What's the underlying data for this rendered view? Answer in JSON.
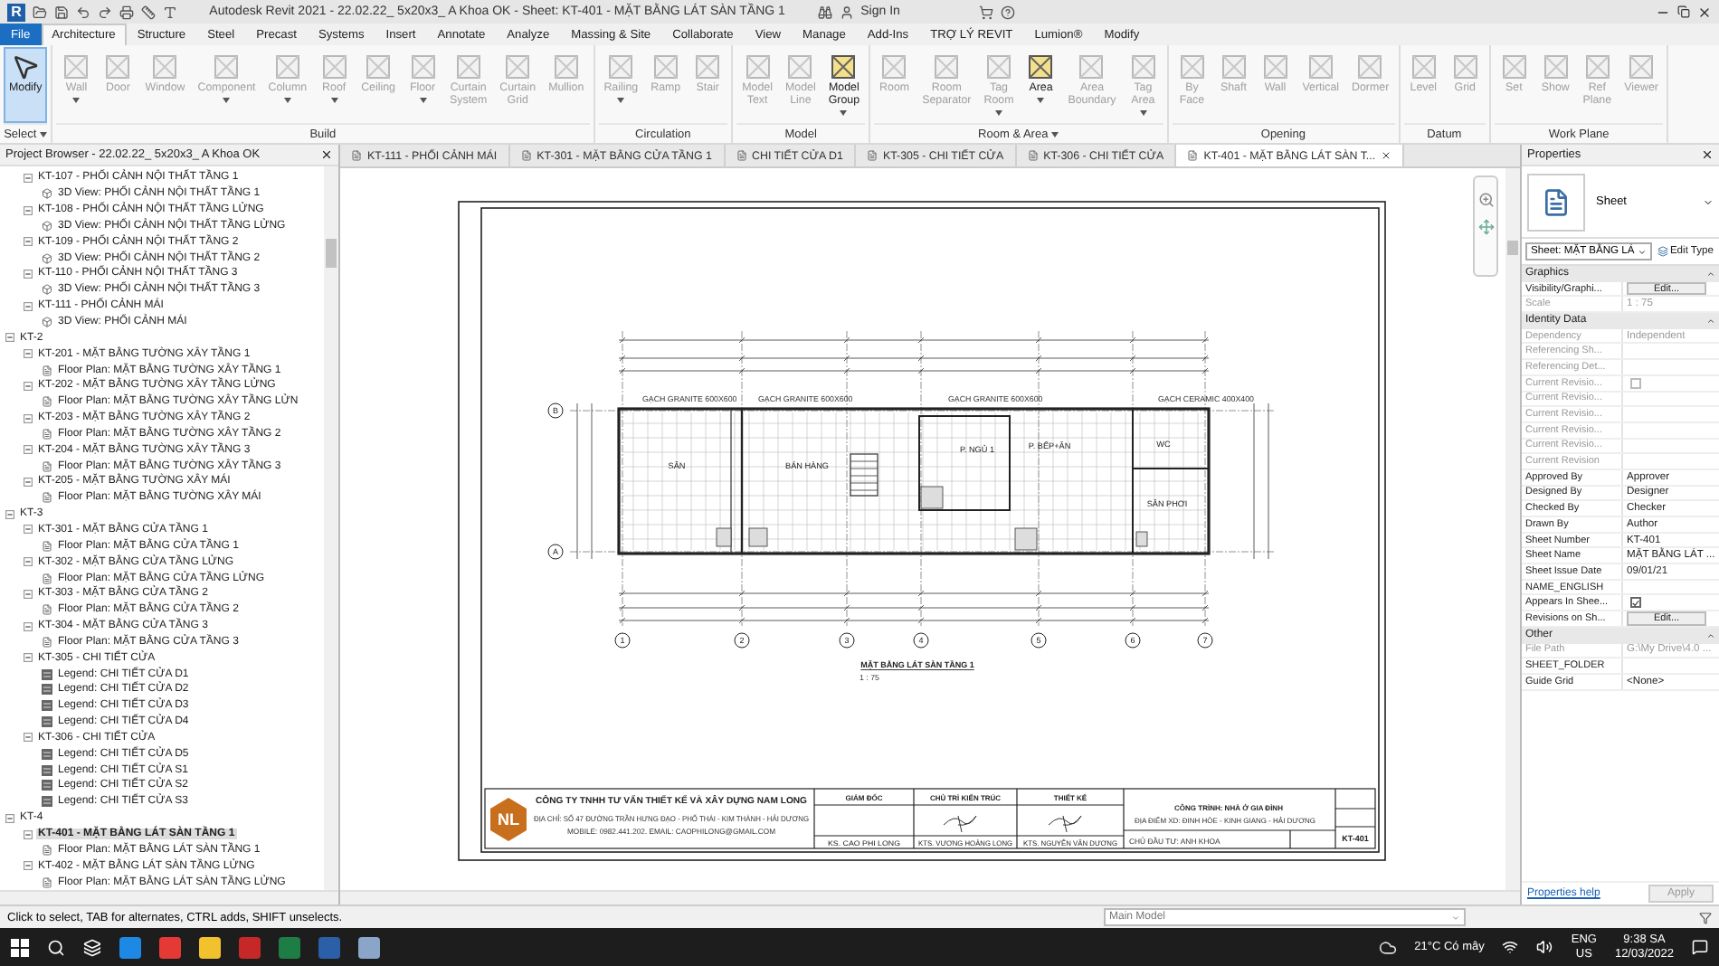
{
  "title_bar": {
    "logo": "R",
    "title": "Autodesk Revit 2021 - 22.02.22_ 5x20x3_ A Khoa OK - Sheet: KT-401 - MẶT BẰNG LÁT SÀN TẦNG 1",
    "sign_in": "Sign In"
  },
  "ribbon": {
    "tabs": [
      {
        "label": "File",
        "kind": "file",
        "selected": false
      },
      {
        "label": "Architecture",
        "kind": "tab",
        "selected": true
      },
      {
        "label": "Structure",
        "kind": "tab",
        "selected": false
      },
      {
        "label": "Steel",
        "kind": "tab",
        "selected": false
      },
      {
        "label": "Precast",
        "kind": "tab",
        "selected": false
      },
      {
        "label": "Systems",
        "kind": "tab",
        "selected": false
      },
      {
        "label": "Insert",
        "kind": "tab",
        "selected": false
      },
      {
        "label": "Annotate",
        "kind": "tab",
        "selected": false
      },
      {
        "label": "Analyze",
        "kind": "tab",
        "selected": false
      },
      {
        "label": "Massing & Site",
        "kind": "tab",
        "selected": false
      },
      {
        "label": "Collaborate",
        "kind": "tab",
        "selected": false
      },
      {
        "label": "View",
        "kind": "tab",
        "selected": false
      },
      {
        "label": "Manage",
        "kind": "tab",
        "selected": false
      },
      {
        "label": "Add-Ins",
        "kind": "tab",
        "selected": false
      },
      {
        "label": "TRỢ LÝ REVIT",
        "kind": "tab",
        "selected": false
      },
      {
        "label": "Lumion®",
        "kind": "tab",
        "selected": false
      },
      {
        "label": "Modify",
        "kind": "tab",
        "selected": false
      }
    ],
    "panels": [
      {
        "label": "Select",
        "menu": true,
        "buttons": [
          {
            "label": "Modify",
            "active": true,
            "disabled": false,
            "dropdown": false
          }
        ]
      },
      {
        "label": "Build",
        "menu": false,
        "buttons": [
          {
            "label": "Wall",
            "active": false,
            "disabled": true,
            "dropdown": true
          },
          {
            "label": "Door",
            "active": false,
            "disabled": true,
            "dropdown": false
          },
          {
            "label": "Window",
            "active": false,
            "disabled": true,
            "dropdown": false
          },
          {
            "label": "Component",
            "active": false,
            "disabled": true,
            "dropdown": true
          },
          {
            "label": "Column",
            "active": false,
            "disabled": true,
            "dropdown": true
          },
          {
            "label": "Roof",
            "active": false,
            "disabled": true,
            "dropdown": true
          },
          {
            "label": "Ceiling",
            "active": false,
            "disabled": true,
            "dropdown": false
          },
          {
            "label": "Floor",
            "active": false,
            "disabled": true,
            "dropdown": true
          },
          {
            "label": "Curtain System",
            "active": false,
            "disabled": true,
            "dropdown": false
          },
          {
            "label": "Curtain Grid",
            "active": false,
            "disabled": true,
            "dropdown": false
          },
          {
            "label": "Mullion",
            "active": false,
            "disabled": true,
            "dropdown": false
          }
        ]
      },
      {
        "label": "Circulation",
        "menu": false,
        "buttons": [
          {
            "label": "Railing",
            "active": false,
            "disabled": true,
            "dropdown": true
          },
          {
            "label": "Ramp",
            "active": false,
            "disabled": true,
            "dropdown": false
          },
          {
            "label": "Stair",
            "active": false,
            "disabled": true,
            "dropdown": false
          }
        ]
      },
      {
        "label": "Model",
        "menu": false,
        "buttons": [
          {
            "label": "Model Text",
            "active": false,
            "disabled": true,
            "dropdown": false
          },
          {
            "label": "Model Line",
            "active": false,
            "disabled": true,
            "dropdown": false
          },
          {
            "label": "Model Group",
            "active": false,
            "disabled": false,
            "dropdown": true
          }
        ]
      },
      {
        "label": "Room & Area",
        "menu": true,
        "buttons": [
          {
            "label": "Room",
            "active": false,
            "disabled": true,
            "dropdown": false
          },
          {
            "label": "Room Separator",
            "active": false,
            "disabled": true,
            "dropdown": false
          },
          {
            "label": "Tag Room",
            "active": false,
            "disabled": true,
            "dropdown": true
          },
          {
            "label": "Area",
            "active": false,
            "disabled": false,
            "dropdown": true
          },
          {
            "label": "Area Boundary",
            "active": false,
            "disabled": true,
            "dropdown": false
          },
          {
            "label": "Tag Area",
            "active": false,
            "disabled": true,
            "dropdown": true
          }
        ]
      },
      {
        "label": "Opening",
        "menu": false,
        "buttons": [
          {
            "label": "By Face",
            "active": false,
            "disabled": true,
            "dropdown": false
          },
          {
            "label": "Shaft",
            "active": false,
            "disabled": true,
            "dropdown": false
          },
          {
            "label": "Wall",
            "active": false,
            "disabled": true,
            "dropdown": false
          },
          {
            "label": "Vertical",
            "active": false,
            "disabled": true,
            "dropdown": false
          },
          {
            "label": "Dormer",
            "active": false,
            "disabled": true,
            "dropdown": false
          }
        ]
      },
      {
        "label": "Datum",
        "menu": false,
        "buttons": [
          {
            "label": "Level",
            "active": false,
            "disabled": true,
            "dropdown": false
          },
          {
            "label": "Grid",
            "active": false,
            "disabled": true,
            "dropdown": false
          }
        ]
      },
      {
        "label": "Work Plane",
        "menu": false,
        "buttons": [
          {
            "label": "Set",
            "active": false,
            "disabled": true,
            "dropdown": false
          },
          {
            "label": "Show",
            "active": false,
            "disabled": true,
            "dropdown": false
          },
          {
            "label": "Ref Plane",
            "active": false,
            "disabled": true,
            "dropdown": false
          },
          {
            "label": "Viewer",
            "active": false,
            "disabled": true,
            "dropdown": false
          }
        ]
      }
    ]
  },
  "browser": {
    "title": "Project Browser - 22.02.22_ 5x20x3_ A Khoa OK",
    "tree": [
      {
        "children": [
          {
            "label": "KT-107 - PHỐI CẢNH NỘI THẤT TẦNG 1",
            "expanded": true,
            "selected": false,
            "children": [
              {
                "label": "3D View: PHỐI CẢNH NỘI THẤT TẦNG 1",
                "kind": "view3d",
                "selected": false
              }
            ]
          },
          {
            "label": "KT-108 - PHỐI CẢNH NỘI THẤT TẦNG LỬNG",
            "expanded": true,
            "selected": false,
            "children": [
              {
                "label": "3D View: PHỐI CẢNH NỘI THẤT TẦNG LỬNG",
                "kind": "view3d",
                "selected": false
              }
            ]
          },
          {
            "label": "KT-109 - PHỐI CẢNH NỘI THẤT TẦNG 2",
            "expanded": true,
            "selected": false,
            "children": [
              {
                "label": "3D View: PHỐI CẢNH NỘI THẤT TẦNG 2",
                "kind": "view3d",
                "selected": false
              }
            ]
          },
          {
            "label": "KT-110 - PHỐI CẢNH NỘI THẤT TẦNG 3",
            "expanded": true,
            "selected": false,
            "children": [
              {
                "label": "3D View: PHỐI CẢNH NỘI THẤT TẦNG 3",
                "kind": "view3d",
                "selected": false
              }
            ]
          },
          {
            "label": "KT-111 - PHỐI CẢNH MÁI",
            "expanded": true,
            "selected": false,
            "children": [
              {
                "label": "3D View: PHỐI CẢNH MÁI",
                "kind": "view3d",
                "selected": false
              }
            ]
          }
        ]
      },
      {
        "label": "KT-2",
        "expanded": true,
        "selected": false,
        "children": [
          {
            "label": "KT-201 - MẶT BẰNG TƯỜNG XÂY TẦNG 1",
            "expanded": true,
            "selected": false,
            "children": [
              {
                "label": "Floor Plan: MẶT BẰNG TƯỜNG XÂY TẦNG 1",
                "kind": "plan",
                "selected": false
              }
            ]
          },
          {
            "label": "KT-202 - MẶT BẰNG TƯỜNG XÂY TẦNG LỬNG",
            "expanded": true,
            "selected": false,
            "children": [
              {
                "label": "Floor Plan: MẶT BẰNG TƯỜNG XÂY TẦNG LỬN",
                "kind": "plan",
                "selected": false
              }
            ]
          },
          {
            "label": "KT-203 - MẶT BẰNG TƯỜNG XÂY TẦNG 2",
            "expanded": true,
            "selected": false,
            "children": [
              {
                "label": "Floor Plan: MẶT BẰNG TƯỜNG XÂY TẦNG 2",
                "kind": "plan",
                "selected": false
              }
            ]
          },
          {
            "label": "KT-204 - MẶT BẰNG TƯỜNG XÂY TẦNG 3",
            "expanded": true,
            "selected": false,
            "children": [
              {
                "label": "Floor Plan: MẶT BẰNG TƯỜNG XÂY TẦNG 3",
                "kind": "plan",
                "selected": false
              }
            ]
          },
          {
            "label": "KT-205 - MẶT BẰNG TƯỜNG XÂY MÁI",
            "expanded": true,
            "selected": false,
            "children": [
              {
                "label": "Floor Plan: MẶT BẰNG TƯỜNG XÂY MÁI",
                "kind": "plan",
                "selected": false
              }
            ]
          }
        ]
      },
      {
        "label": "KT-3",
        "expanded": true,
        "selected": false,
        "children": [
          {
            "label": "KT-301 - MẶT BẰNG CỬA TẦNG 1",
            "expanded": true,
            "selected": false,
            "children": [
              {
                "label": "Floor Plan: MẶT BẰNG CỬA TẦNG 1",
                "kind": "plan",
                "selected": false
              }
            ]
          },
          {
            "label": "KT-302 - MẶT BẰNG CỬA TẦNG LỬNG",
            "expanded": true,
            "selected": false,
            "children": [
              {
                "label": "Floor Plan: MẶT BẰNG CỬA TẦNG LỬNG",
                "kind": "plan",
                "selected": false
              }
            ]
          },
          {
            "label": "KT-303 - MẶT BẰNG CỬA TẦNG 2",
            "expanded": true,
            "selected": false,
            "children": [
              {
                "label": "Floor Plan: MẶT BẰNG CỬA TẦNG 2",
                "kind": "plan",
                "selected": false
              }
            ]
          },
          {
            "label": "KT-304 - MẶT BẰNG CỬA TẦNG 3",
            "expanded": true,
            "selected": false,
            "children": [
              {
                "label": "Floor Plan: MẶT BẰNG CỬA TẦNG 3",
                "kind": "plan",
                "selected": false
              }
            ]
          },
          {
            "label": "KT-305 - CHI TIẾT CỬA",
            "expanded": true,
            "selected": false,
            "children": [
              {
                "label": "Legend: CHI TIẾT CỬA D1",
                "kind": "legend",
                "selected": false
              },
              {
                "label": "Legend: CHI TIẾT CỬA D2",
                "kind": "legend",
                "selected": false
              },
              {
                "label": "Legend: CHI TIẾT CỬA D3",
                "kind": "legend",
                "selected": false
              },
              {
                "label": "Legend: CHI TIẾT CỬA D4",
                "kind": "legend",
                "selected": false
              }
            ]
          },
          {
            "label": "KT-306 - CHI TIẾT CỬA",
            "expanded": true,
            "selected": false,
            "children": [
              {
                "label": "Legend: CHI TIẾT CỬA D5",
                "kind": "legend",
                "selected": false
              },
              {
                "label": "Legend: CHI TIẾT CỬA S1",
                "kind": "legend",
                "selected": false
              },
              {
                "label": "Legend: CHI TIẾT CỬA S2",
                "kind": "legend",
                "selected": false
              },
              {
                "label": "Legend: CHI TIẾT CỬA S3",
                "kind": "legend",
                "selected": false
              }
            ]
          }
        ]
      },
      {
        "label": "KT-4",
        "expanded": true,
        "selected": false,
        "children": [
          {
            "label": "KT-401 - MẶT BẰNG LÁT SÀN TẦNG 1",
            "expanded": true,
            "selected": true,
            "children": [
              {
                "label": "Floor Plan: MẶT BẰNG LÁT SÀN TẦNG 1",
                "kind": "plan",
                "selected": false
              }
            ]
          },
          {
            "label": "KT-402 - MẶT BẰNG LÁT SÀN TẦNG LỬNG",
            "expanded": true,
            "selected": false,
            "children": [
              {
                "label": "Floor Plan: MẶT BẰNG LÁT SÀN TẦNG LỬNG",
                "kind": "plan",
                "selected": false
              }
            ]
          }
        ]
      }
    ]
  },
  "view_tabs": [
    {
      "label": "KT-111 - PHỐI CẢNH MÁI",
      "selected": false
    },
    {
      "label": "KT-301 - MẶT BẰNG CỬA TẦNG 1",
      "selected": false
    },
    {
      "label": "CHI TIẾT CỬA D1",
      "selected": false
    },
    {
      "label": "KT-305 - CHI TIẾT CỬA",
      "selected": false
    },
    {
      "label": "KT-306 - CHI TIẾT CỬA",
      "selected": false
    },
    {
      "label": "KT-401 - MẶT BẰNG LÁT SÀN T...",
      "selected": true
    }
  ],
  "sheet": {
    "tile_labels": [
      "GẠCH GRANITE 600X600",
      "GẠCH GRANITE 600X600",
      "GẠCH GRANITE 600X600",
      "GẠCH CERAMIC 400X400"
    ],
    "rooms": [
      "SÂN",
      "BÁN HÀNG",
      "P. NGỦ 1",
      "P. BẾP+ĂN",
      "WC",
      "SÂN PHƠI"
    ],
    "column_grids": [
      "1",
      "2",
      "3",
      "4",
      "5",
      "6",
      "7"
    ],
    "row_grids": [
      "B",
      "A"
    ],
    "title": "MẶT BẰNG LÁT SÀN TẦNG 1",
    "scale": "1 : 75",
    "title_block": {
      "logo": "NL",
      "company": "CÔNG TY TNHH TƯ VẤN THIẾT KẾ VÀ XÂY DỰNG NAM LONG",
      "address": [
        "ĐỊA CHỈ: SỐ 47 ĐƯỜNG TRẦN HƯNG ĐẠO - PHỐ THÁI - KIM THÀNH - HẢI DƯƠNG",
        "MOBILE: 0982.441.202. EMAIL: CAOPHILONG@GMAIL.COM"
      ],
      "roles": [
        {
          "role": "GIÁM ĐỐC",
          "name": "KS. CAO PHI LONG",
          "signed": false
        },
        {
          "role": "CHỦ TRÌ KIẾN TRÚC",
          "name": "KTS. VƯƠNG HOÀNG LONG",
          "signed": true
        },
        {
          "role": "THIẾT KẾ",
          "name": "KTS. NGUYỄN VĂN DƯƠNG",
          "signed": true
        }
      ],
      "project": "CÔNG TRÌNH: NHÀ Ở GIA ĐÌNH",
      "location": "ĐỊA ĐIỂM XD: ĐINH HÒE - KINH GIANG - HẢI DƯƠNG",
      "owner": "CHỦ ĐẦU TƯ: ANH KHOA",
      "sheet_number": "KT-401"
    }
  },
  "properties": {
    "title": "Properties",
    "type": "Sheet",
    "selector": "Sheet: MẶT BẰNG LÁ",
    "edit_type": "Edit Type",
    "sections": [
      {
        "title": "Graphics",
        "rows": [
          {
            "name": "Visibility/Graphi...",
            "value": "Edit...",
            "kind": "button",
            "disabled": false
          },
          {
            "name": "Scale",
            "value": "1 : 75",
            "kind": "text",
            "disabled": true
          }
        ]
      },
      {
        "title": "Identity Data",
        "rows": [
          {
            "name": "Dependency",
            "value": "Independent",
            "kind": "text",
            "disabled": true
          },
          {
            "name": "Referencing Sh...",
            "kind": "text",
            "disabled": true
          },
          {
            "name": "Referencing Det...",
            "kind": "text",
            "disabled": true
          },
          {
            "name": "Current Revisio...",
            "kind": "checkbox",
            "checked": false,
            "disabled": true
          },
          {
            "name": "Current Revisio...",
            "kind": "text",
            "disabled": true
          },
          {
            "name": "Current Revisio...",
            "kind": "text",
            "disabled": true
          },
          {
            "name": "Current Revisio...",
            "kind": "text",
            "disabled": true
          },
          {
            "name": "Current Revisio...",
            "kind": "text",
            "disabled": true
          },
          {
            "name": "Current Revision",
            "kind": "text",
            "disabled": true
          },
          {
            "name": "Approved By",
            "value": "Approver",
            "kind": "text",
            "disabled": false
          },
          {
            "name": "Designed By",
            "value": "Designer",
            "kind": "text",
            "disabled": false
          },
          {
            "name": "Checked By",
            "value": "Checker",
            "kind": "text",
            "disabled": false
          },
          {
            "name": "Drawn By",
            "value": "Author",
            "kind": "text",
            "disabled": false
          },
          {
            "name": "Sheet Number",
            "value": "KT-401",
            "kind": "text",
            "disabled": false
          },
          {
            "name": "Sheet Name",
            "value": "MẶT BẰNG LÁT ...",
            "kind": "text",
            "disabled": false
          },
          {
            "name": "Sheet Issue Date",
            "value": "09/01/21",
            "kind": "text",
            "disabled": false
          },
          {
            "name": "NAME_ENGLISH",
            "kind": "text",
            "disabled": false
          },
          {
            "name": "Appears In Shee...",
            "kind": "checkbox",
            "checked": true,
            "disabled": false
          },
          {
            "name": "Revisions on Sh...",
            "value": "Edit...",
            "kind": "button",
            "disabled": false
          }
        ]
      },
      {
        "title": "Other",
        "rows": [
          {
            "name": "File Path",
            "value": "G:\\My Drive\\4.0 ...",
            "kind": "text",
            "disabled": true
          },
          {
            "name": "SHEET_FOLDER",
            "kind": "text",
            "disabled": false
          },
          {
            "name": "Guide Grid",
            "value": "<None>",
            "kind": "text",
            "disabled": false
          }
        ]
      }
    ],
    "help": "Properties help",
    "apply": "Apply"
  },
  "status_bar": {
    "message": "Click to select, TAB for alternates, CTRL adds, SHIFT unselects.",
    "model": "Main Model"
  },
  "taskbar": {
    "weather": "21°C Có mây",
    "language": [
      "ENG",
      "US"
    ],
    "time": "9:38 SA",
    "date": "12/03/2022"
  }
}
